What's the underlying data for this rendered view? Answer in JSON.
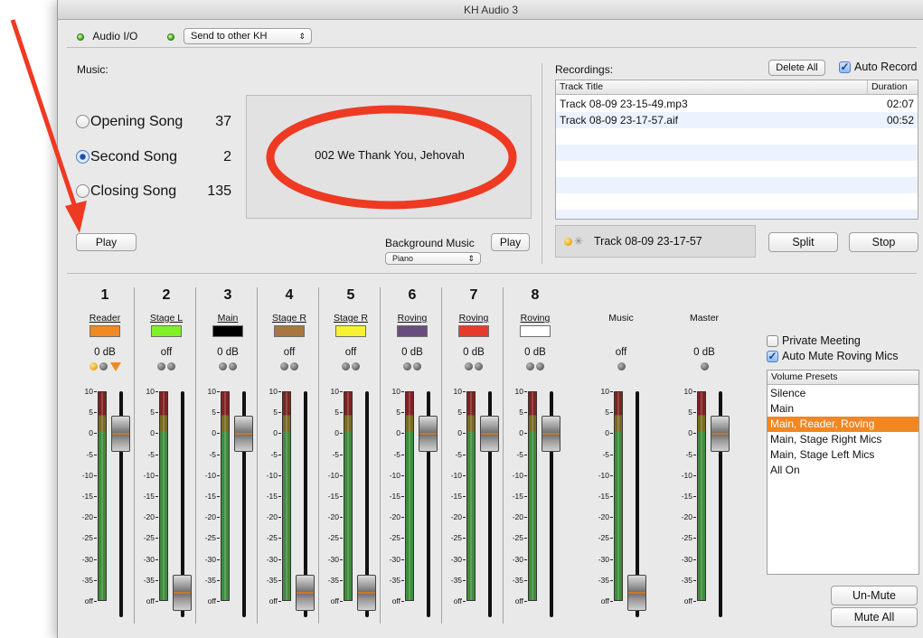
{
  "window": {
    "title": "KH Audio 3"
  },
  "toolbar": {
    "audio_io": "Audio I/O",
    "send_select": "Send to other KH",
    "send_arrow": "⇕"
  },
  "music": {
    "label": "Music:",
    "songs": [
      {
        "label": "Opening Song",
        "number": "37",
        "selected": false
      },
      {
        "label": "Second Song",
        "number": "2",
        "selected": true
      },
      {
        "label": "Closing Song",
        "number": "135",
        "selected": false
      }
    ],
    "now_playing": "002 We Thank You, Jehovah",
    "play_button": "Play",
    "background_music_label": "Background Music",
    "background_play_button": "Play",
    "background_select": "Piano",
    "background_arrow": "⇕"
  },
  "recordings": {
    "label": "Recordings:",
    "delete_all": "Delete All",
    "auto_record": "Auto Record",
    "auto_record_checked": true,
    "columns": [
      "Track Title",
      "Duration"
    ],
    "rows": [
      {
        "title": "Track 08-09 23-15-49.mp3",
        "duration": "02:07"
      },
      {
        "title": "Track 08-09 23-17-57.aif",
        "duration": "00:52"
      }
    ],
    "current_track": "Track 08-09 23-17-57",
    "split_button": "Split",
    "stop_button": "Stop"
  },
  "mixer": {
    "scale_labels": [
      "10",
      "5",
      "0",
      "-5",
      "-10",
      "-15",
      "-20",
      "-25",
      "-30",
      "-35",
      "off"
    ],
    "channels": [
      {
        "num": "1",
        "name": "Reader",
        "color": "#f18a22",
        "level": "0 dB"
      },
      {
        "num": "2",
        "name": "Stage L",
        "color": "#80f028",
        "level": "off"
      },
      {
        "num": "3",
        "name": "Main",
        "color": "#000000",
        "level": "0 dB"
      },
      {
        "num": "4",
        "name": "Stage R",
        "color": "#a8763e",
        "level": "off"
      },
      {
        "num": "5",
        "name": "Stage R",
        "color": "#f6f232",
        "level": "off"
      },
      {
        "num": "6",
        "name": "Roving",
        "color": "#6a4d7e",
        "level": "0 dB"
      },
      {
        "num": "7",
        "name": "Roving",
        "color": "#e8392d",
        "level": "0 dB"
      },
      {
        "num": "8",
        "name": "Roving",
        "color": "#ffffff",
        "level": "0 dB"
      }
    ],
    "music_channel": {
      "name": "Music",
      "level": "off"
    },
    "master_channel": {
      "name": "Master",
      "level": "0 dB"
    }
  },
  "options": {
    "private_meeting": "Private Meeting",
    "private_meeting_checked": false,
    "auto_mute": "Auto Mute Roving Mics",
    "auto_mute_checked": true
  },
  "presets": {
    "header": "Volume Presets",
    "items": [
      "Silence",
      "Main",
      "Main, Reader, Roving",
      "Main, Stage Right Mics",
      "Main, Stage Left Mics",
      "All On"
    ],
    "selected_index": 2
  },
  "buttons": {
    "unmute": "Un-Mute",
    "mute_all": "Mute All"
  },
  "colors": {
    "annotation": "#ee3a23",
    "selection": "#f08722"
  }
}
